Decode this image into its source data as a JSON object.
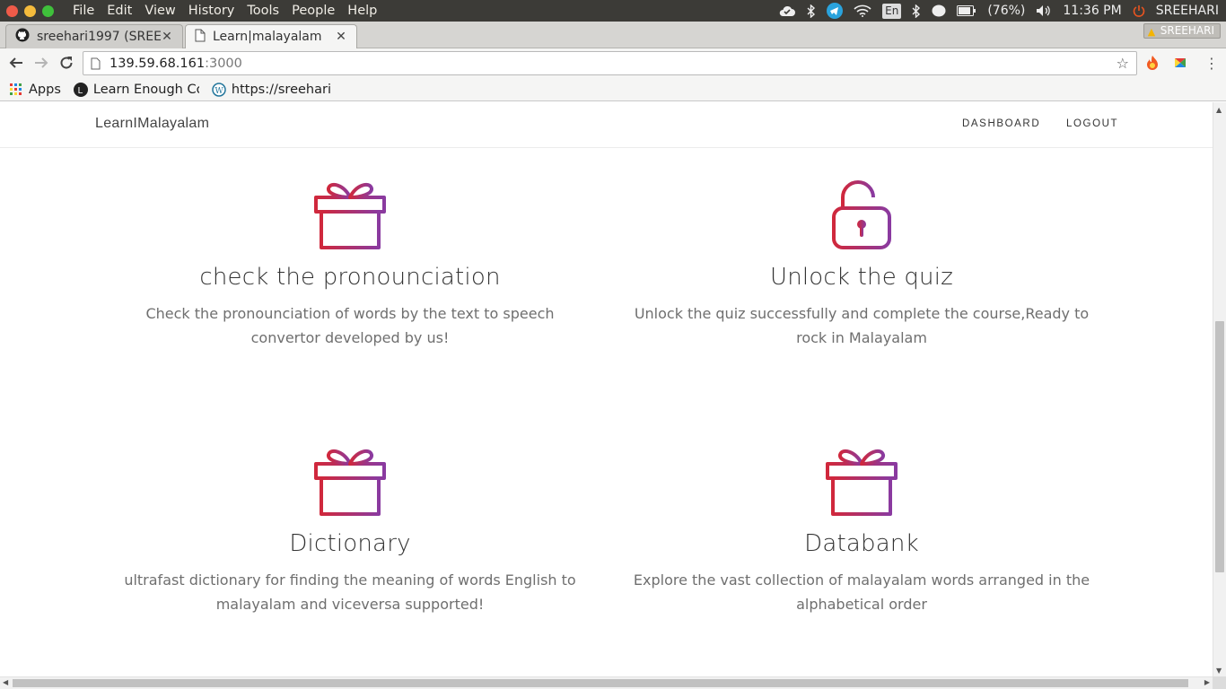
{
  "os": {
    "menu": [
      "File",
      "Edit",
      "View",
      "History",
      "Tools",
      "People",
      "Help"
    ],
    "battery": "(76%)",
    "time": "11:36 PM",
    "user": "SREEHARI",
    "keyboard": "En"
  },
  "tabs": [
    {
      "label": "sreehari1997 (SREE",
      "icon": "github-icon"
    },
    {
      "label": "Learn|malayalam",
      "icon": "page-icon"
    }
  ],
  "profile_badge": "SREEHARI",
  "address": {
    "host": "139.59.68.161",
    "port": ":3000"
  },
  "bookmarks": [
    {
      "label": "Apps",
      "icon": "apps-grid-icon"
    },
    {
      "label": "Learn Enough Co",
      "icon": "learn-enough-icon"
    },
    {
      "label": "https://sreehari",
      "icon": "wordpress-icon"
    }
  ],
  "site": {
    "brand": "LearnIMalayalam",
    "nav": [
      "DASHBOARD",
      "LOGOUT"
    ]
  },
  "features": [
    {
      "icon": "gift-icon",
      "title": "check the pronounciation",
      "desc": "Check the pronounciation of words by the text to speech convertor developed by us!"
    },
    {
      "icon": "unlock-icon",
      "title": "Unlock the quiz",
      "desc": "Unlock the quiz successfully and complete the course,Ready to rock in Malayalam"
    },
    {
      "icon": "gift-icon",
      "title": "Dictionary",
      "desc": "ultrafast dictionary for finding the meaning of words English to malayalam and viceversa supported!"
    },
    {
      "icon": "gift-icon",
      "title": "Databank",
      "desc": "Explore the vast collection of malayalam words arranged in the alphabetical order"
    }
  ],
  "colors": {
    "icon_gradient_start": "#d0283c",
    "icon_gradient_end": "#8a3aa0"
  }
}
